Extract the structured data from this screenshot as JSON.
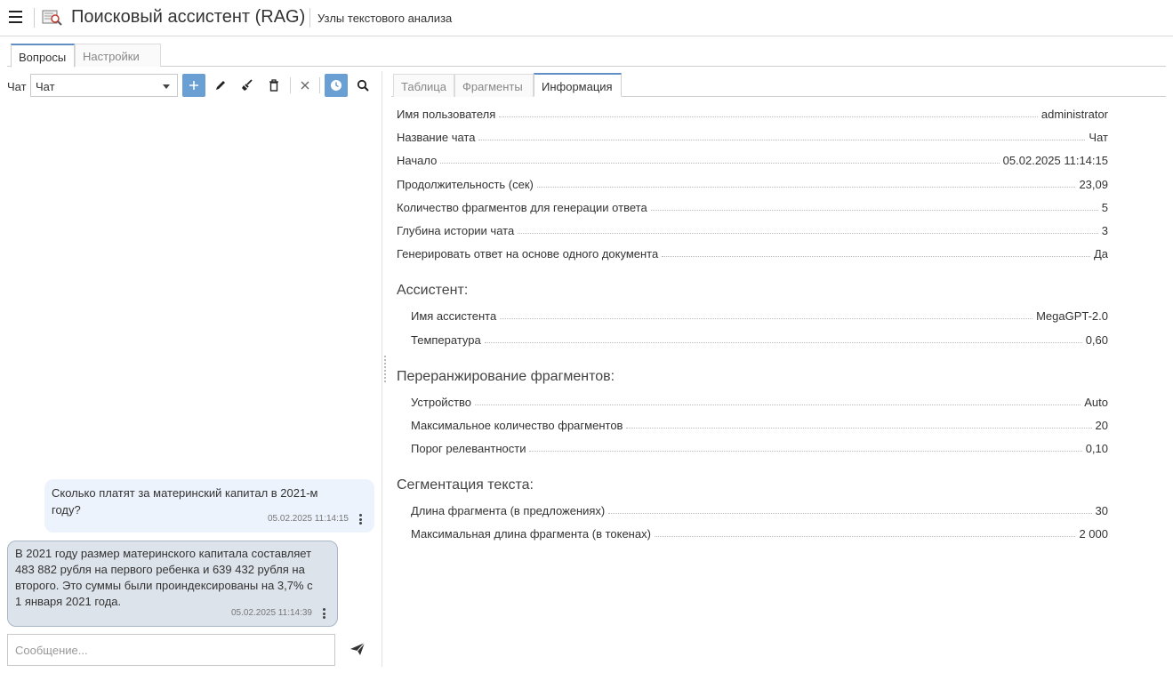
{
  "header": {
    "title": "Поисковый ассистент (RAG)",
    "subtitle": "Узлы текстового анализа"
  },
  "top_tabs": [
    {
      "label": "Вопросы",
      "active": true
    },
    {
      "label": "Настройки",
      "active": false
    }
  ],
  "left": {
    "chat_label": "Чат",
    "chat_select_value": "Чат",
    "toolbar_icons": [
      "plus-icon",
      "pencil-icon",
      "broom-icon",
      "trash-icon",
      "close-icon",
      "clock-icon",
      "search-icon"
    ],
    "messages": [
      {
        "role": "user",
        "text": "Сколько платят за материнский капитал в 2021-м году?",
        "time": "05.02.2025 11:14:15"
      },
      {
        "role": "assistant",
        "text": "В 2021 году размер материнского капитала составляет 483 882 рубля на первого ребенка и 639 432 рубля на второго. Это суммы были проиндексированы на 3,7% с 1 января 2021 года.",
        "time": "05.02.2025 11:14:39"
      }
    ],
    "message_placeholder": "Сообщение..."
  },
  "right_tabs": [
    {
      "label": "Таблица",
      "active": false
    },
    {
      "label": "Фрагменты",
      "active": false
    },
    {
      "label": "Информация",
      "active": true
    }
  ],
  "info": {
    "general": [
      {
        "key": "Имя пользователя",
        "value": "administrator"
      },
      {
        "key": "Название чата",
        "value": "Чат"
      },
      {
        "key": "Начало",
        "value": "05.02.2025 11:14:15"
      },
      {
        "key": "Продолжительность (сек)",
        "value": "23,09"
      },
      {
        "key": "Количество фрагментов для генерации ответа",
        "value": "5"
      },
      {
        "key": "Глубина истории чата",
        "value": "3"
      },
      {
        "key": "Генерировать ответ на основе одного документа",
        "value": "Да"
      }
    ],
    "assistant_title": "Ассистент:",
    "assistant": [
      {
        "key": "Имя ассистента",
        "value": "MegaGPT-2.0"
      },
      {
        "key": "Температура",
        "value": "0,60"
      }
    ],
    "rerank_title": "Переранжирование фрагментов:",
    "rerank": [
      {
        "key": "Устройство",
        "value": "Auto"
      },
      {
        "key": "Максимальное количество фрагментов",
        "value": "20"
      },
      {
        "key": "Порог релевантности",
        "value": "0,10"
      }
    ],
    "segment_title": "Сегментация текста:",
    "segment": [
      {
        "key": "Длина фрагмента (в предложениях)",
        "value": "30"
      },
      {
        "key": "Максимальная длина фрагмента (в токенах)",
        "value": "2 000"
      }
    ]
  },
  "colors": {
    "accent": "#6a9fd4",
    "user_bubble": "#edf3fc",
    "assistant_bubble": "#dde3ea",
    "tab_active_border": "#5f8fc5"
  }
}
